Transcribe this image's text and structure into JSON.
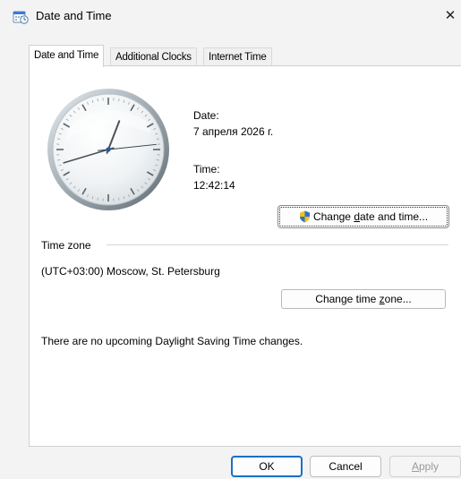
{
  "window": {
    "title": "Date and Time",
    "close_glyph": "✕",
    "icon": "date-time-app-icon"
  },
  "tabs": [
    {
      "label": "Date and Time",
      "active": true
    },
    {
      "label": "Additional Clocks",
      "active": false
    },
    {
      "label": "Internet Time",
      "active": false
    }
  ],
  "datetime": {
    "date_label": "Date:",
    "date_value": "7 апреля 2026 г.",
    "time_label": "Time:",
    "time_value": "12:42:14",
    "change_button": {
      "before": "Change ",
      "mnemonic": "d",
      "after": "ate and time..."
    },
    "clock_time": {
      "hours": 12,
      "minutes": 42,
      "seconds": 14
    }
  },
  "timezone": {
    "section_label": "Time zone",
    "value": "(UTC+03:00) Moscow, St. Petersburg",
    "change_button": {
      "before": "Change time ",
      "mnemonic": "z",
      "after": "one..."
    }
  },
  "dst_message": "There are no upcoming Daylight Saving Time changes.",
  "footer": {
    "ok": "OK",
    "cancel": "Cancel",
    "apply": {
      "mnemonic": "A",
      "after": "pply"
    }
  },
  "colors": {
    "accent": "#1a6fc4",
    "shield_blue": "#2f6fd1",
    "shield_yellow": "#f2c21b"
  }
}
